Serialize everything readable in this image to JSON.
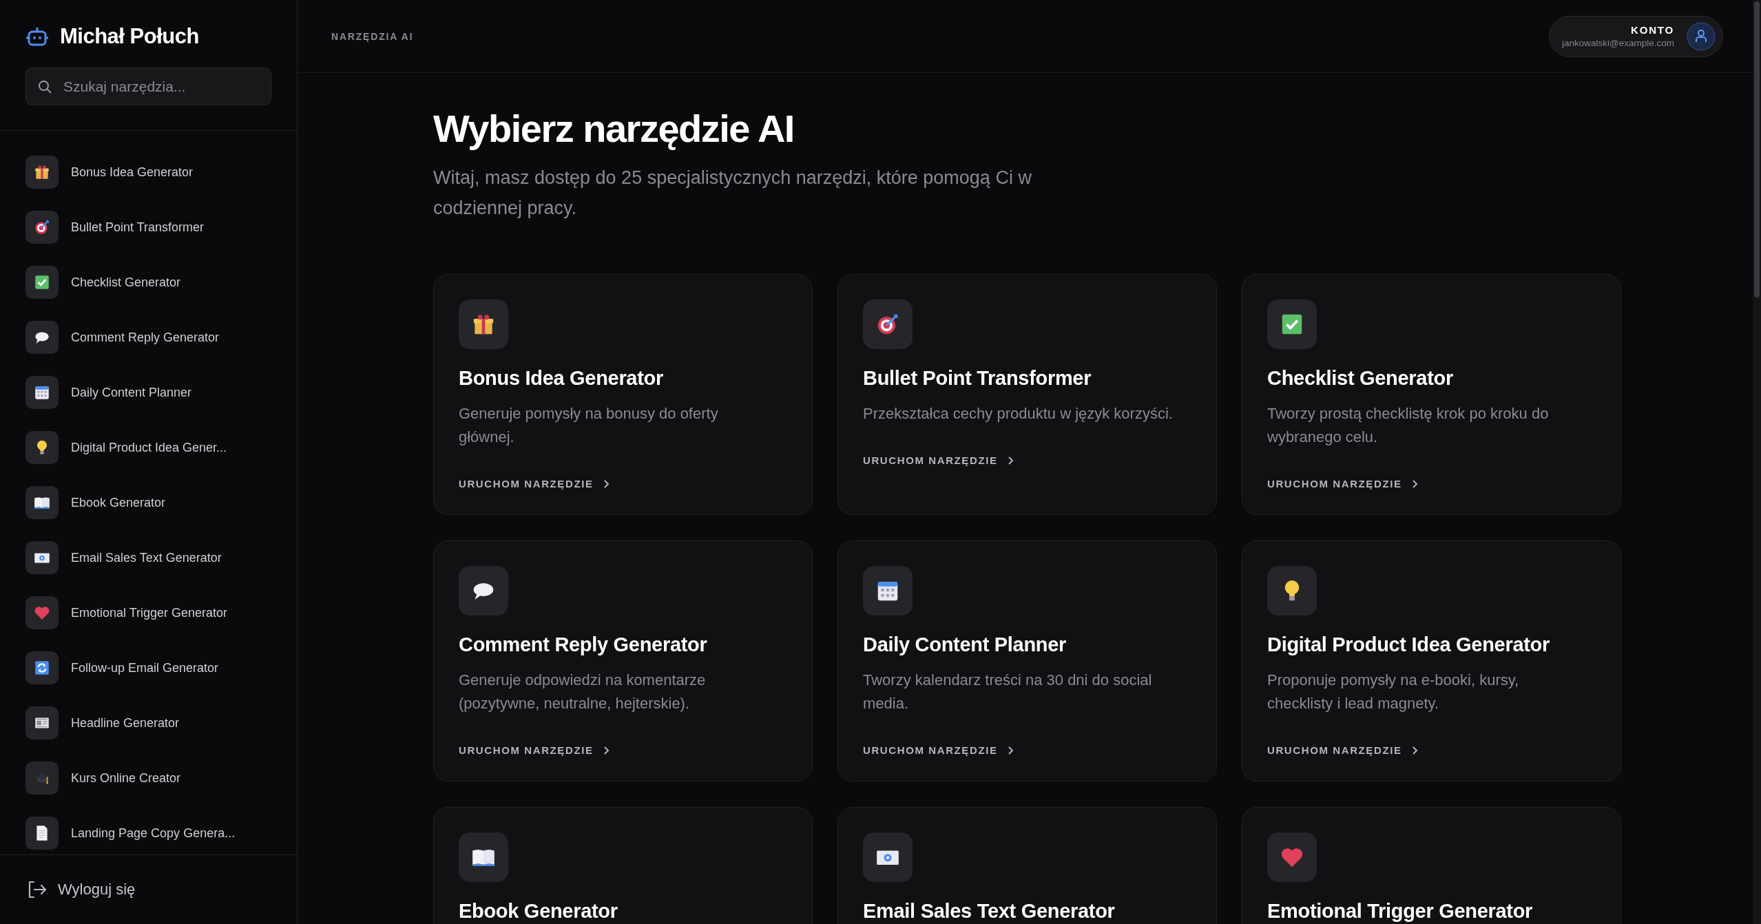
{
  "brand": {
    "name": "Michał Połuch"
  },
  "search": {
    "placeholder": "Szukaj narzędzia..."
  },
  "sidebar": {
    "items": [
      {
        "label": "Bonus Idea Generator"
      },
      {
        "label": "Bullet Point Transformer"
      },
      {
        "label": "Checklist Generator"
      },
      {
        "label": "Comment Reply Generator"
      },
      {
        "label": "Daily Content Planner"
      },
      {
        "label": "Digital Product Idea Gener..."
      },
      {
        "label": "Ebook Generator"
      },
      {
        "label": "Email Sales Text Generator"
      },
      {
        "label": "Emotional Trigger Generator"
      },
      {
        "label": "Follow-up Email Generator"
      },
      {
        "label": "Headline Generator"
      },
      {
        "label": "Kurs Online Creator"
      },
      {
        "label": "Landing Page Copy Genera..."
      }
    ]
  },
  "logout": {
    "label": "Wyloguj się"
  },
  "header": {
    "breadcrumb": "NARZĘDZIA AI",
    "account": {
      "label": "KONTO",
      "email": "jankowalski@example.com"
    }
  },
  "main": {
    "title": "Wybierz narzędzie AI",
    "subtitle": "Witaj, masz dostęp do 25 specjalistycznych narzędzi, które pomogą Ci w codziennej pracy.",
    "cards": [
      {
        "title": "Bonus Idea Generator",
        "description": "Generuje pomysły na bonusy do oferty głównej.",
        "action": "URUCHOM NARZĘDZIE"
      },
      {
        "title": "Bullet Point Transformer",
        "description": "Przekształca cechy produktu w język korzyści.",
        "action": "URUCHOM NARZĘDZIE"
      },
      {
        "title": "Checklist Generator",
        "description": "Tworzy prostą checklistę krok po kroku do wybranego celu.",
        "action": "URUCHOM NARZĘDZIE"
      },
      {
        "title": "Comment Reply Generator",
        "description": "Generuje odpowiedzi na komentarze (pozytywne, neutralne, hejterskie).",
        "action": "URUCHOM NARZĘDZIE"
      },
      {
        "title": "Daily Content Planner",
        "description": "Tworzy kalendarz treści na 30 dni do social media.",
        "action": "URUCHOM NARZĘDZIE"
      },
      {
        "title": "Digital Product Idea Generator",
        "description": "Proponuje pomysły na e-booki, kursy, checklisty i lead magnety.",
        "action": "URUCHOM NARZĘDZIE"
      },
      {
        "title": "Ebook Generator"
      },
      {
        "title": "Email Sales Text Generator"
      },
      {
        "title": "Emotional Trigger Generator"
      }
    ]
  }
}
